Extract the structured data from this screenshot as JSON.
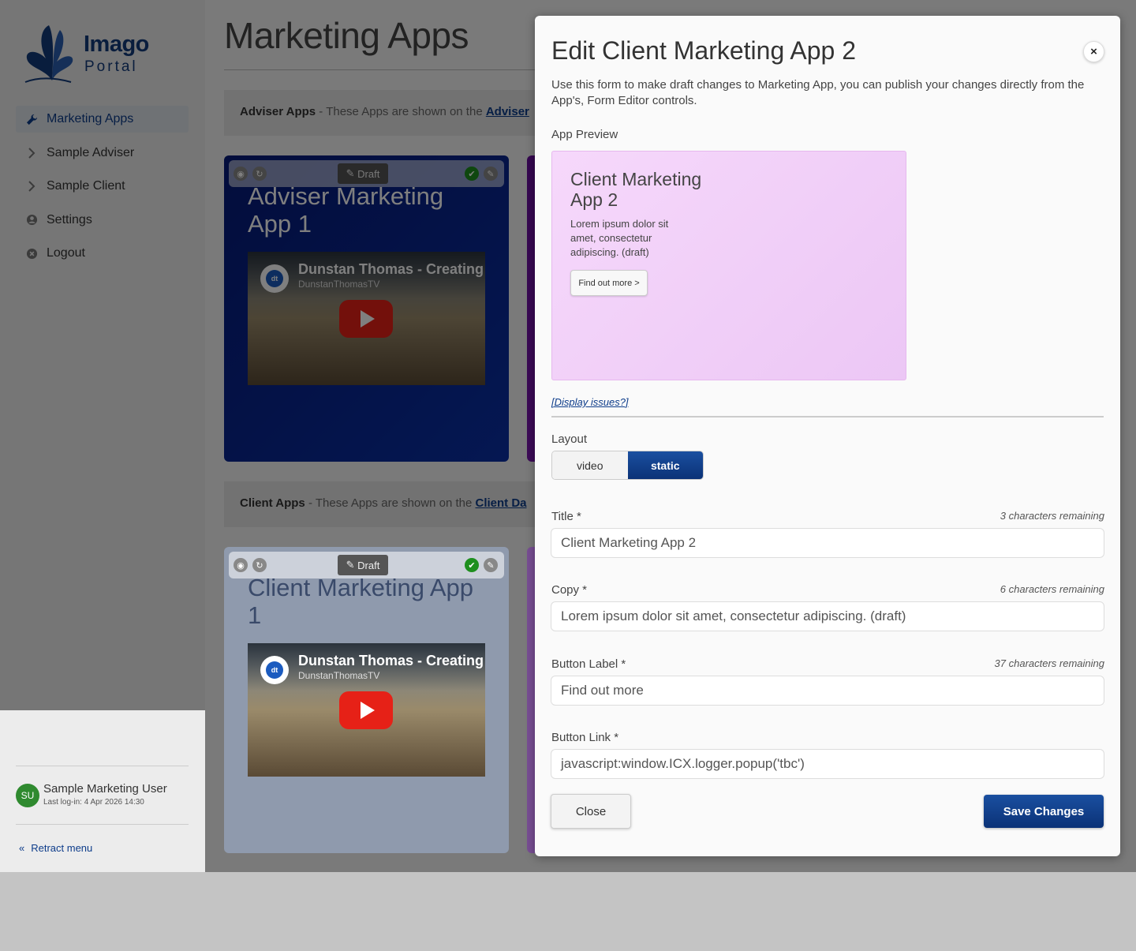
{
  "logo": {
    "line1": "Imago",
    "line2": "Portal"
  },
  "nav": [
    {
      "label": "Marketing Apps",
      "icon": "wrench-icon"
    },
    {
      "label": "Sample Adviser",
      "icon": "chevron-right-icon"
    },
    {
      "label": "Sample Client",
      "icon": "chevron-right-icon"
    },
    {
      "label": "Settings",
      "icon": "user-circle-icon"
    },
    {
      "label": "Logout",
      "icon": "x-circle-icon"
    }
  ],
  "user": {
    "initials": "SU",
    "name": "Sample Marketing User",
    "last_login": "Last log-in: 4 Apr 2026 14:30"
  },
  "retract_label": "Retract menu",
  "main": {
    "title": "Marketing Apps",
    "adviser_section": {
      "bold": "Adviser Apps",
      "text": " - These Apps are shown on the ",
      "link": "Adviser"
    },
    "client_section": {
      "bold": "Client Apps",
      "text": " - These Apps are shown on the ",
      "link": "Client Da"
    },
    "cards": [
      {
        "draft_label": "Draft",
        "title": "Adviser Marketing App 1",
        "video_title": "Dunstan Thomas - Creating",
        "video_channel": "DunstanThomasTV",
        "video_logo": "dt"
      },
      {
        "draft_label": "Draft",
        "title": "Client Marketing App 1",
        "video_title": "Dunstan Thomas - Creating",
        "video_channel": "DunstanThomasTV",
        "video_logo": "dt"
      }
    ]
  },
  "modal": {
    "title": "Edit Client Marketing App 2",
    "close_symbol": "×",
    "description": "Use this form to make draft changes to Marketing App, you can publish your changes directly from the App's, Form Editor controls.",
    "preview_label": "App Preview",
    "preview": {
      "title": "Client Marketing App 2",
      "copy": "Lorem ipsum dolor sit amet, consectetur adipiscing. (draft)",
      "button": "Find out more >"
    },
    "display_issues": "[Display issues?]",
    "layout_label": "Layout",
    "layout_options": [
      "video",
      "static"
    ],
    "layout_selected": "static",
    "fields": [
      {
        "label": "Title *",
        "hint": "3 characters remaining",
        "value": "Client Marketing App 2"
      },
      {
        "label": "Copy *",
        "hint": "6 characters remaining",
        "value": "Lorem ipsum dolor sit amet, consectetur adipiscing. (draft)"
      },
      {
        "label": "Button Label *",
        "hint": "37 characters remaining",
        "value": "Find out more"
      },
      {
        "label": "Button Link *",
        "hint": "",
        "value": "javascript:window.ICX.logger.popup('tbc')"
      }
    ],
    "close_button": "Close",
    "save_button": "Save Changes"
  },
  "colors": {
    "brand": "#0d3c8a",
    "primary_button": "#0b3277",
    "preview_bg": "#f3d4fa",
    "adviser_card": "#0a2fa5",
    "client_card": "#8a1dbf"
  }
}
